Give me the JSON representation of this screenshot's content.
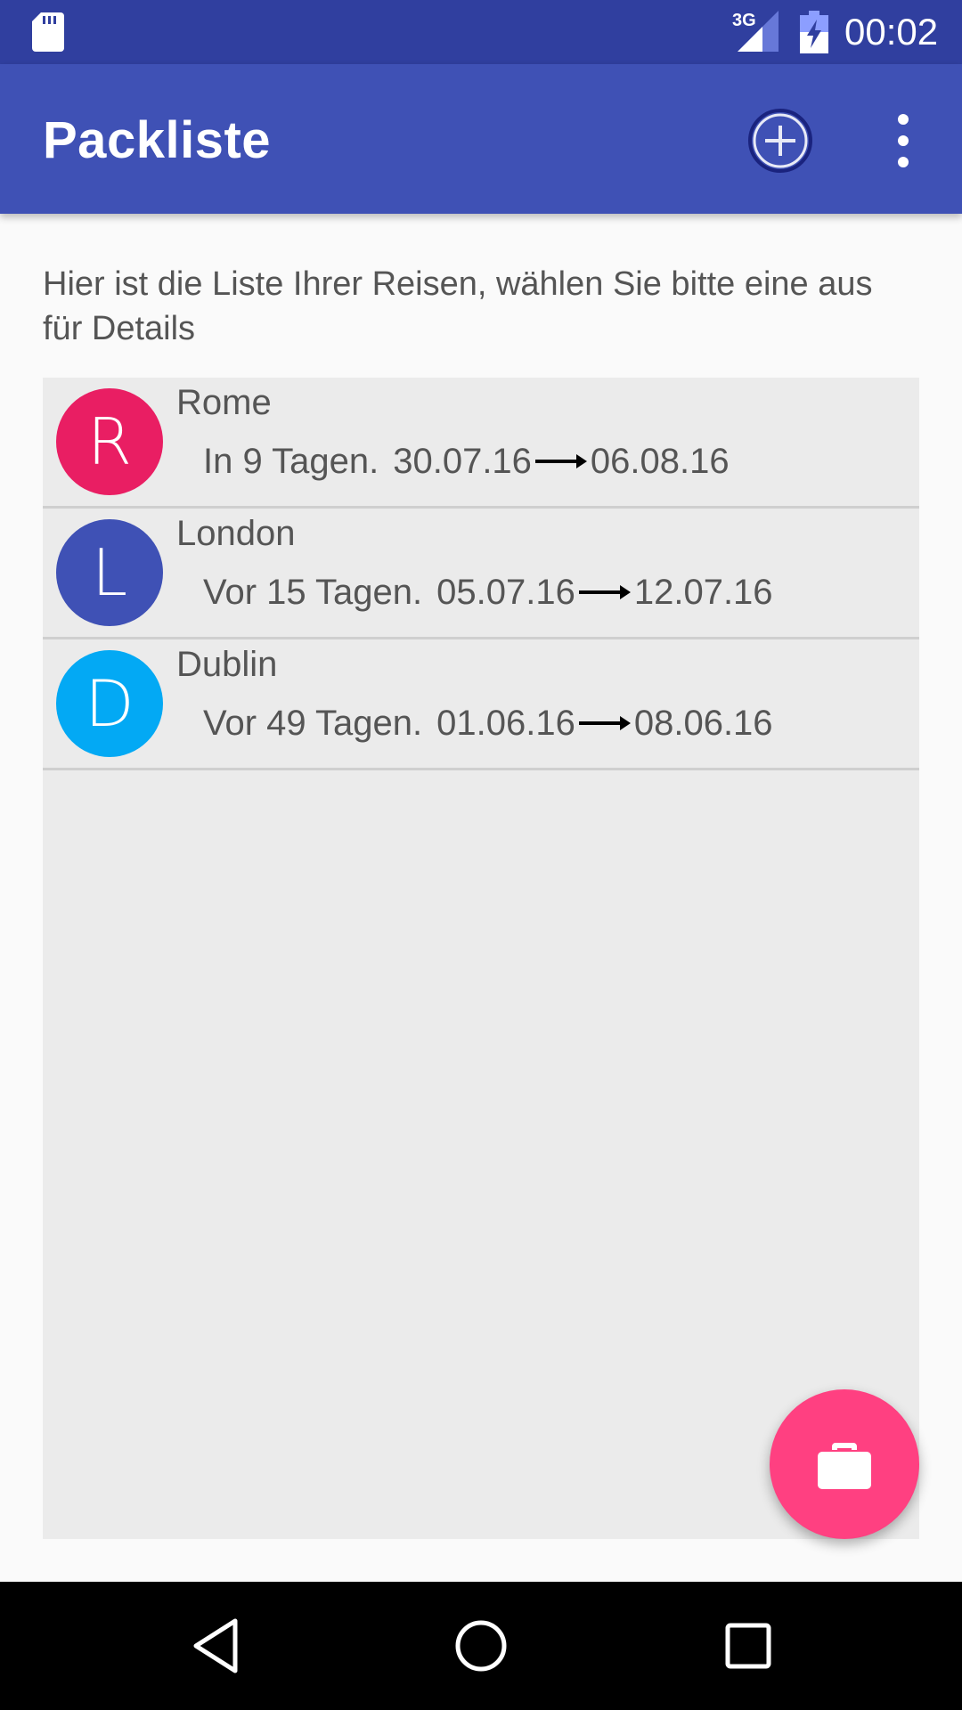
{
  "status_bar": {
    "time": "00:02",
    "network": "3G",
    "icons": [
      "sd-card-icon",
      "signal-icon",
      "battery-charging-icon"
    ]
  },
  "app_bar": {
    "title": "Packliste",
    "actions": [
      "add-circle-icon",
      "more-vert-icon"
    ]
  },
  "intro_text": "Hier ist die Liste Ihrer Reisen, wählen Sie bitte eine aus für Details",
  "trips": [
    {
      "initial": "R",
      "name": "Rome",
      "relative": "In 9 Tagen.",
      "start": "30.07.16",
      "end": "06.08.16",
      "color": "#e91e63"
    },
    {
      "initial": "L",
      "name": "London",
      "relative": "Vor 15 Tagen.",
      "start": "05.07.16",
      "end": "12.07.16",
      "color": "#3f51b5"
    },
    {
      "initial": "D",
      "name": "Dublin",
      "relative": "Vor 49 Tagen.",
      "start": "01.06.16",
      "end": "08.06.16",
      "color": "#03a9f4"
    }
  ],
  "fab": {
    "icon": "briefcase-icon",
    "color": "#ff4081"
  },
  "colors": {
    "primary": "#3f51b5",
    "primary_dark": "#303f9f",
    "accent": "#ff4081"
  },
  "nav_bar": [
    "back-icon",
    "home-icon",
    "recents-icon"
  ]
}
